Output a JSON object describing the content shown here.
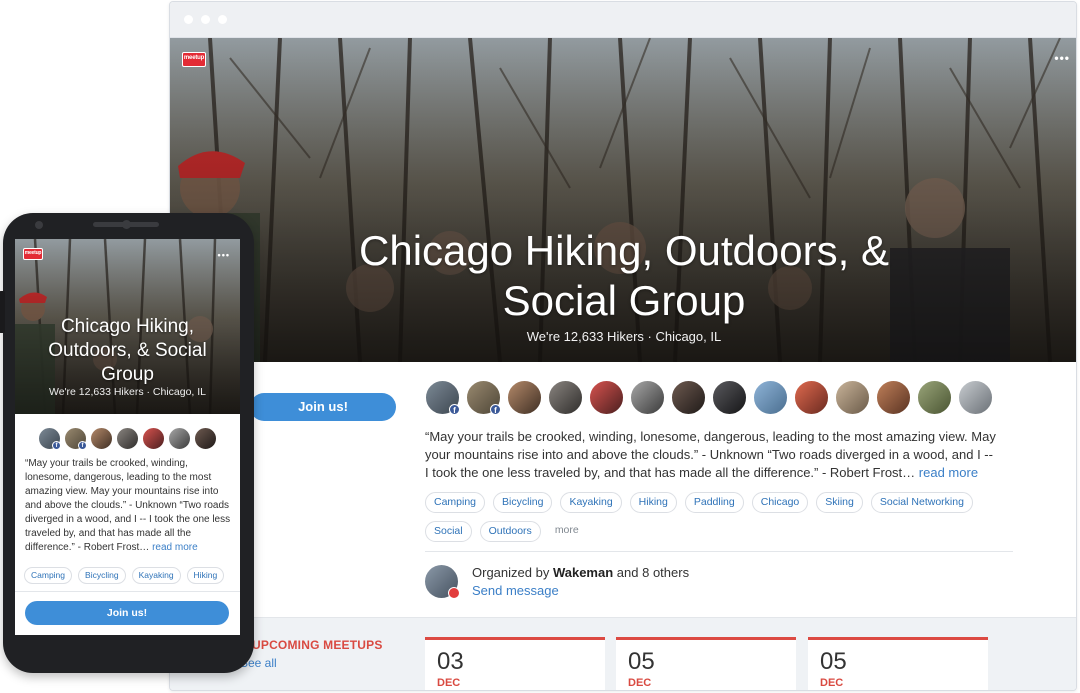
{
  "desktop": {
    "group_title": "Chicago Hiking, Outdoors, & Social Group",
    "subtitle": "We're 12,633 Hikers · Chicago, IL",
    "logo_text": "meetup",
    "menu_icon": "more-icon",
    "join_label": "Join us!",
    "description": "“May your trails be crooked, winding, lonesome, dangerous, leading to the most amazing view. May your mountains rise into and above the clouds.” - Unknown “Two roads diverged in a wood, and I -- I took the one less traveled by, and that has made all the difference.” - Robert Frost…",
    "read_more": "read more",
    "tags": [
      "Camping",
      "Bicycling",
      "Kayaking",
      "Hiking",
      "Paddling",
      "Chicago",
      "Skiing",
      "Social Networking",
      "Social",
      "Outdoors"
    ],
    "tags_more": "more",
    "organizer_prefix": "Organized by",
    "organizer_name": "Wakeman",
    "organizer_suffix": "and 8 others",
    "send_message": "Send message",
    "upcoming_title": "UPCOMING MEETUPS",
    "see_all": "See all",
    "meetups": [
      {
        "day": "03",
        "month": "DEC"
      },
      {
        "day": "05",
        "month": "DEC"
      },
      {
        "day": "05",
        "month": "DEC"
      }
    ]
  },
  "mobile": {
    "group_title": "Chicago Hiking, Outdoors, & Social Group",
    "subtitle": "We're 12,633 Hikers · Chicago, IL",
    "logo_text": "meetup",
    "description": "“May your trails be crooked, winding, lonesome, dangerous, leading to the most amazing view. May your mountains rise into and above the clouds.” - Unknown “Two roads diverged in a wood, and I -- I took the one less traveled by, and that has made all the difference.” - Robert Frost…",
    "read_more": "read more",
    "tags": [
      "Camping",
      "Bicycling",
      "Kayaking",
      "Hiking"
    ],
    "join_label": "Join us!"
  },
  "colors": {
    "accent_blue": "#3e8ed8",
    "link_blue": "#3b7fc7",
    "meetup_red": "#e32b35",
    "section_red": "#d94a41"
  }
}
